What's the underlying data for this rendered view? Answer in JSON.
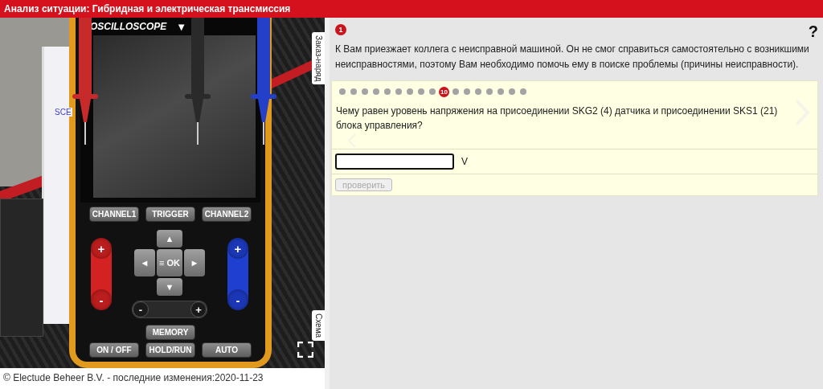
{
  "title": "Анализ ситуации: Гибридная и электрическая трансмиссия",
  "simulation": {
    "scope_label": "OSCILLOSCOPE",
    "scope_menu_glyph": "▼",
    "panel_label": "SCE",
    "side_tabs": [
      "Заказ-наряд",
      "Схема"
    ],
    "top_buttons": [
      "CHANNEL1",
      "TRIGGER",
      "CHANNEL2"
    ],
    "rockers": [
      {
        "color": "#d42222",
        "plus": "+",
        "minus": "-"
      },
      {
        "color": "#1f3fd0",
        "plus": "+",
        "minus": "-"
      }
    ],
    "dpad": {
      "up": "▲",
      "left": "◄",
      "ok": "≡ OK",
      "right": "►",
      "down": "▼"
    },
    "zoom": {
      "minus": "-",
      "plus": "+"
    },
    "memory_button": "MEMORY",
    "bottom_buttons": [
      "ON / OFF",
      "HOLD/RUN",
      "AUTO"
    ]
  },
  "footer": "© Electude Beheer B.V. - последние изменения:2020-11-23",
  "task": {
    "number": "1",
    "help": "?",
    "intro": "К Вам приезжает коллега с неисправной машиной. Он не смог справиться самостоятельно с возникшими неисправностями, поэтому Вам необходимо помочь ему в поиске проблемы (причины неисправности).",
    "steps": [
      {
        "selected": false
      },
      {
        "selected": false
      },
      {
        "selected": false
      },
      {
        "selected": false
      },
      {
        "selected": false
      },
      {
        "selected": false
      },
      {
        "selected": false
      },
      {
        "selected": false
      },
      {
        "selected": false
      },
      {
        "selected": true,
        "label": "10"
      },
      {
        "selected": false
      },
      {
        "selected": false
      },
      {
        "selected": false
      },
      {
        "selected": false
      },
      {
        "selected": false
      },
      {
        "selected": false
      },
      {
        "selected": false
      }
    ],
    "question": "Чему равен уровень напряжения на присоединении SKG2 (4) датчика и присоединении SKS1 (21) блока управления?",
    "answer": {
      "unit": "V"
    },
    "check_button": {
      "label": "проверить",
      "disabled": true
    }
  }
}
